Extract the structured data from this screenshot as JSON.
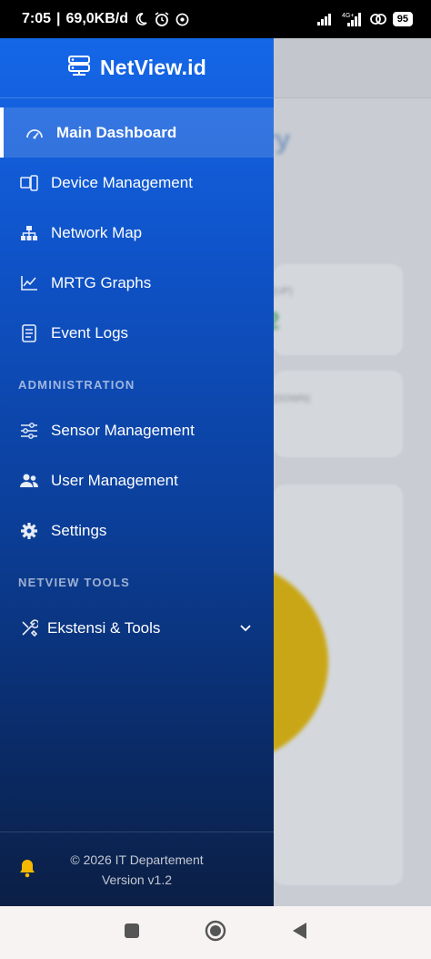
{
  "status_bar": {
    "time": "7:05",
    "speed": "69,0KB/d",
    "network": "4G+",
    "battery": "95"
  },
  "drawer": {
    "brand": "NetView.id",
    "items": [
      {
        "label": "Main Dashboard",
        "icon": "dashboard-icon",
        "active": true
      },
      {
        "label": "Device Management",
        "icon": "devices-icon"
      },
      {
        "label": "Network Map",
        "icon": "sitemap-icon"
      },
      {
        "label": "MRTG Graphs",
        "icon": "chart-line-icon"
      },
      {
        "label": "Event Logs",
        "icon": "log-icon"
      }
    ],
    "section_admin": "ADMINISTRATION",
    "admin_items": [
      {
        "label": "Sensor Management",
        "icon": "sliders-icon"
      },
      {
        "label": "User Management",
        "icon": "users-icon"
      },
      {
        "label": "Settings",
        "icon": "gear-icon"
      }
    ],
    "section_tools": "NETVIEW TOOLS",
    "tools_item": {
      "label": "Ekstensi & Tools",
      "icon": "tools-icon"
    },
    "footer_copyright": "© 2026 IT Departement",
    "footer_version": "Version v1.2"
  },
  "colors": {
    "drawer_top": "#1567e8",
    "drawer_bottom": "#0b1f45",
    "bell": "#f5b800"
  }
}
